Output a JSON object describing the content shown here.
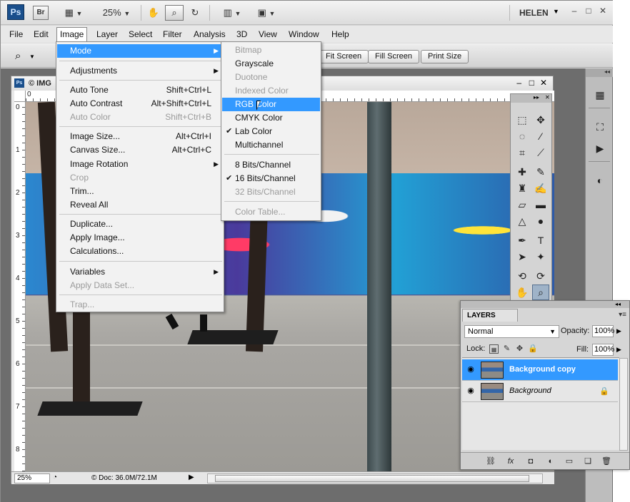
{
  "app": {
    "logo_text": "Ps",
    "bridge_text": "Br",
    "zoom_value": "25%",
    "user": "HELEN"
  },
  "menubar": [
    "File",
    "Edit",
    "Image",
    "Layer",
    "Select",
    "Filter",
    "Analysis",
    "3D",
    "View",
    "Window",
    "Help"
  ],
  "options_bar": {
    "buttons": [
      "Fit Screen",
      "Fill Screen",
      "Print Size"
    ]
  },
  "document": {
    "title": "© IMG",
    "zoom": "25%",
    "doc_size": "© Doc: 36.0M/72.1M",
    "ruler_h": [
      "0"
    ],
    "ruler_v": [
      "0",
      "1",
      "2",
      "3",
      "4",
      "5",
      "6",
      "7",
      "8"
    ]
  },
  "image_menu": {
    "items": [
      {
        "label": "Mode",
        "shortcut": "",
        "submenu": true,
        "disabled": false,
        "highlighted": true
      },
      {
        "sep": true
      },
      {
        "label": "Adjustments",
        "shortcut": "",
        "submenu": true,
        "disabled": false
      },
      {
        "sep": true
      },
      {
        "label": "Auto Tone",
        "shortcut": "Shift+Ctrl+L",
        "disabled": false
      },
      {
        "label": "Auto Contrast",
        "shortcut": "Alt+Shift+Ctrl+L",
        "disabled": false
      },
      {
        "label": "Auto Color",
        "shortcut": "Shift+Ctrl+B",
        "disabled": true
      },
      {
        "sep": true
      },
      {
        "label": "Image Size...",
        "shortcut": "Alt+Ctrl+I",
        "disabled": false
      },
      {
        "label": "Canvas Size...",
        "shortcut": "Alt+Ctrl+C",
        "disabled": false
      },
      {
        "label": "Image Rotation",
        "shortcut": "",
        "submenu": true,
        "disabled": false
      },
      {
        "label": "Crop",
        "shortcut": "",
        "disabled": true
      },
      {
        "label": "Trim...",
        "shortcut": "",
        "disabled": false
      },
      {
        "label": "Reveal All",
        "shortcut": "",
        "disabled": false
      },
      {
        "sep": true
      },
      {
        "label": "Duplicate...",
        "shortcut": "",
        "disabled": false
      },
      {
        "label": "Apply Image...",
        "shortcut": "",
        "disabled": false
      },
      {
        "label": "Calculations...",
        "shortcut": "",
        "disabled": false
      },
      {
        "sep": true
      },
      {
        "label": "Variables",
        "shortcut": "",
        "submenu": true,
        "disabled": false
      },
      {
        "label": "Apply Data Set...",
        "shortcut": "",
        "disabled": true
      },
      {
        "sep": true
      },
      {
        "label": "Trap...",
        "shortcut": "",
        "disabled": true
      }
    ]
  },
  "mode_menu": {
    "items": [
      {
        "label": "Bitmap",
        "disabled": true
      },
      {
        "label": "Grayscale",
        "disabled": false
      },
      {
        "label": "Duotone",
        "disabled": true
      },
      {
        "label": "Indexed Color",
        "disabled": true
      },
      {
        "label": "RGB Color",
        "disabled": false,
        "highlighted": true
      },
      {
        "label": "CMYK Color",
        "disabled": false
      },
      {
        "label": "Lab Color",
        "disabled": false,
        "checked": true
      },
      {
        "label": "Multichannel",
        "disabled": false
      },
      {
        "sep": true
      },
      {
        "label": "8 Bits/Channel",
        "disabled": false
      },
      {
        "label": "16 Bits/Channel",
        "disabled": false,
        "checked": true
      },
      {
        "label": "32 Bits/Channel",
        "disabled": true
      },
      {
        "sep": true
      },
      {
        "label": "Color Table...",
        "disabled": true
      }
    ]
  },
  "layers_panel": {
    "tab": "LAYERS",
    "blend_mode": "Normal",
    "opacity_label": "Opacity:",
    "opacity": "100%",
    "lock_label": "Lock:",
    "fill_label": "Fill:",
    "fill": "100%",
    "layers": [
      {
        "name": "Background copy",
        "selected": true,
        "locked": false
      },
      {
        "name": "Background",
        "selected": false,
        "locked": true
      }
    ]
  },
  "colors": {
    "highlight": "#3399ff",
    "ps_blue": "#1a4f8c"
  }
}
